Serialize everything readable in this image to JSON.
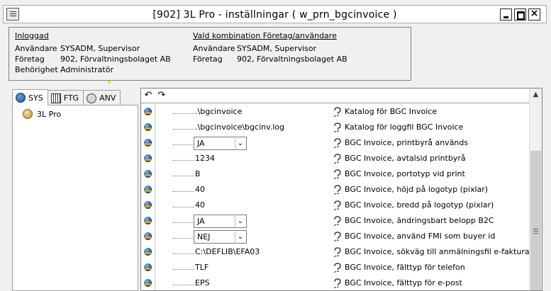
{
  "window": {
    "title": "[902]  3L Pro - inställningar ( w_prn_bgcinvoice )"
  },
  "info": {
    "left": {
      "header": "Inloggad",
      "rows": [
        {
          "label": "Användare",
          "value": "SYSADM, Supervisor"
        },
        {
          "label": "Företag",
          "value": "902, Förvaltningsbolaget AB"
        },
        {
          "label": "Behörighet",
          "value": "Administratör"
        }
      ]
    },
    "right": {
      "header": "Vald kombination Företag/användare",
      "rows": [
        {
          "label": "Användare",
          "value": "SYSADM, Supervisor"
        },
        {
          "label": "Företag",
          "value": "902, Förvaltningsbolaget AB"
        }
      ]
    }
  },
  "tabs": [
    {
      "label": "SYS",
      "icon": "globe-icon",
      "active": true
    },
    {
      "label": "FTG",
      "icon": "building-icon",
      "active": false
    },
    {
      "label": "ANV",
      "icon": "user-icon",
      "active": false
    }
  ],
  "tree": {
    "items": [
      {
        "label": "3L Pro",
        "icon": "app-icon"
      }
    ]
  },
  "toolbar": {
    "icons": [
      "back-icon",
      "forward-icon"
    ]
  },
  "params": [
    {
      "type": "text",
      "value": ".\\bgcinvoice",
      "desc": "Katalog för BGC Invoice"
    },
    {
      "type": "text",
      "value": ".\\bgcinvoice\\bgcinv.log",
      "desc": "Katalog för loggfil BGC Invoice"
    },
    {
      "type": "combo",
      "value": "JA",
      "desc": "BGC Invoice, printbyrå används"
    },
    {
      "type": "text",
      "value": "1234",
      "desc": "BGC Invoice, avtalsid printbyrå"
    },
    {
      "type": "text",
      "value": "B",
      "desc": "BGC Invoice, portotyp vid print"
    },
    {
      "type": "text",
      "value": "40",
      "desc": "BGC Invoice, höjd på logotyp (pixlar)"
    },
    {
      "type": "text",
      "value": "40",
      "desc": "BGC Invoice, bredd på logotyp (pixlar)"
    },
    {
      "type": "combo",
      "value": "JA",
      "desc": "BGC Invoice, ändringsbart belopp B2C"
    },
    {
      "type": "combo",
      "value": "NEJ",
      "desc": "BGC Invoice, använd FMI som buyer id"
    },
    {
      "type": "text",
      "value": "C:\\DEFLIB\\EFA03",
      "desc": "BGC Invoice, sökväg till anmälningsfil e-faktura"
    },
    {
      "type": "text",
      "value": "TLF",
      "desc": "BGC Invoice, fälttyp för telefon"
    },
    {
      "type": "text",
      "value": "EPS",
      "desc": "BGC Invoice, fälttyp för e-post"
    }
  ]
}
